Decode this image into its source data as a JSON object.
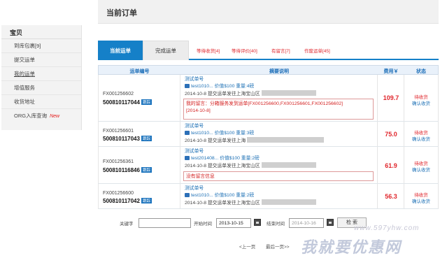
{
  "header": {
    "title": "当前订单"
  },
  "sidebar": {
    "title": "宝贝",
    "items": [
      {
        "label": "到库包裹[9]"
      },
      {
        "label": "提交运单"
      },
      {
        "label": "我的运单"
      },
      {
        "label": "增值服务"
      },
      {
        "label": "收货地址"
      },
      {
        "label": "ORG入库查询",
        "badge": "New"
      }
    ]
  },
  "tabs": {
    "active": "当前运单",
    "done": "完成运单",
    "status_links": [
      "等待收货[4]",
      "等待评价[40]",
      "有留言[7]",
      "作废运单[45]"
    ]
  },
  "table": {
    "headers": [
      "运单编号",
      "摘要说明",
      "费用￥",
      "状态"
    ],
    "track_label": "跟踪",
    "rows": [
      {
        "id_small": "FX001256602",
        "id_big": "500810117044",
        "title": "测试单号",
        "item": "test1010... 价值$100     重量:4磅",
        "date_line": "2014-10-8 提交运单发往上海宝山区",
        "message": "我的留言：分箱服务发到运单[FX001256600,FX001256601,FX001256602]",
        "message_date": "[2014-10-8]",
        "fee": "109.7",
        "status1": "待收货",
        "status2": "确认收货"
      },
      {
        "id_small": "FX001256601",
        "id_big": "500810117043",
        "title": "测试单号",
        "item": "test1010... 价值$100     重量:3磅",
        "date_line": "2014-10-8 提交运单发往上海",
        "fee": "75.0",
        "status1": "待收货",
        "status2": "确认收货"
      },
      {
        "id_small": "FX001256361",
        "id_big": "500810116846",
        "title": "测试单号",
        "item": "test201408... 价值$100     重量:2磅",
        "date_line": "2014-10-8 提交运单发往上海宝山区",
        "message": "没有留言信息",
        "fee": "61.9",
        "status1": "待收货",
        "status2": "确认收货"
      },
      {
        "id_small": "FX001256600",
        "id_big": "500810117042",
        "title": "测试单号",
        "item": "test1010... 价值$100     重量:2磅",
        "date_line": "2014-10-8 提交运单发往上海宝山区",
        "fee": "56.3",
        "status1": "待收货",
        "status2": "确认收货"
      }
    ]
  },
  "search": {
    "keyword_label": "关键字",
    "keyword_value": "",
    "start_label": "开始时间",
    "start_value": "2013-10-15",
    "end_label": "结束时间",
    "end_value": "2014-10-16",
    "button": "检 索"
  },
  "pager": {
    "prev": "<上一页",
    "last": "最后一页>>"
  },
  "watermark": {
    "url": "www.597yhw.com",
    "text": "我就要优惠网"
  },
  "colors": {
    "accent": "#1580c8",
    "red": "#e0262c"
  }
}
